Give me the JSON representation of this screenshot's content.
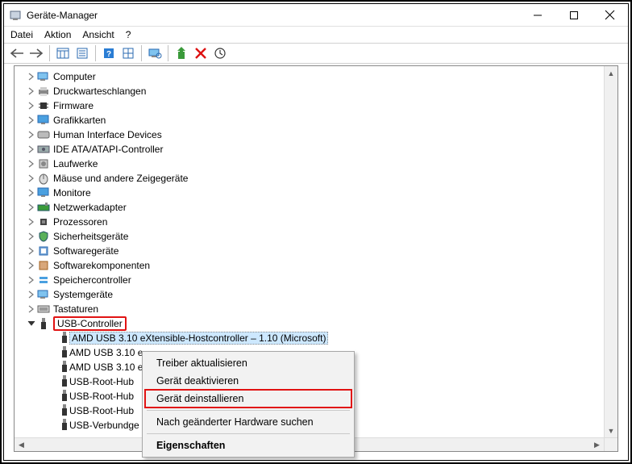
{
  "window": {
    "title": "Geräte-Manager"
  },
  "menu": {
    "file": "Datei",
    "action": "Aktion",
    "view": "Ansicht",
    "help": "?"
  },
  "tree": {
    "items": [
      {
        "label": "Computer"
      },
      {
        "label": "Druckwarteschlangen"
      },
      {
        "label": "Firmware"
      },
      {
        "label": "Grafikkarten"
      },
      {
        "label": "Human Interface Devices"
      },
      {
        "label": "IDE ATA/ATAPI-Controller"
      },
      {
        "label": "Laufwerke"
      },
      {
        "label": "Mäuse und andere Zeigegeräte"
      },
      {
        "label": "Monitore"
      },
      {
        "label": "Netzwerkadapter"
      },
      {
        "label": "Prozessoren"
      },
      {
        "label": "Sicherheitsgeräte"
      },
      {
        "label": "Softwaregeräte"
      },
      {
        "label": "Softwarekomponenten"
      },
      {
        "label": "Speichercontroller"
      },
      {
        "label": "Systemgeräte"
      },
      {
        "label": "Tastaturen"
      }
    ],
    "usb": {
      "label": "USB-Controller",
      "children": [
        {
          "label": "AMD USB 3.10 eXtensible-Hostcontroller – 1.10 (Microsoft)",
          "selected": true
        },
        {
          "label": "AMD USB 3.10 e"
        },
        {
          "label": "AMD USB 3.10 e"
        },
        {
          "label": "USB-Root-Hub"
        },
        {
          "label": "USB-Root-Hub"
        },
        {
          "label": "USB-Root-Hub"
        },
        {
          "label": "USB-Verbundge"
        }
      ]
    }
  },
  "context_menu": {
    "update": "Treiber aktualisieren",
    "disable": "Gerät deaktivieren",
    "uninstall": "Gerät deinstallieren",
    "scan": "Nach geänderter Hardware suchen",
    "properties": "Eigenschaften"
  }
}
